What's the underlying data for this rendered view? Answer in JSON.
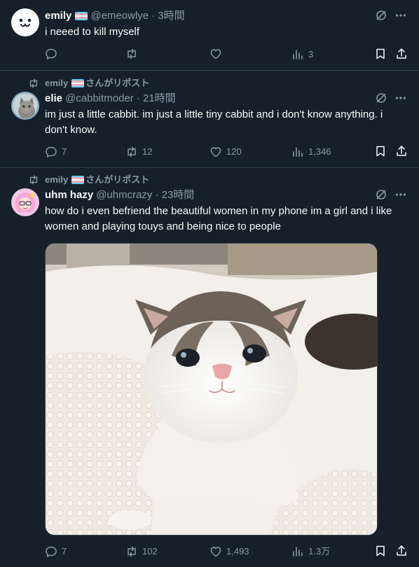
{
  "tweets": [
    {
      "name": "emily",
      "handle": "@emeowlye",
      "time": "· 3時間",
      "text": "i neeed to kill myself",
      "stats": {
        "replies": "",
        "retweets": "",
        "likes": "",
        "views": "3"
      }
    },
    {
      "retweeted_by": "emily",
      "retweet_suffix": "さんがリポスト",
      "name": "elie",
      "handle": "@cabbitmoder",
      "time": "· 21時間",
      "text": "im just a little cabbit. im just a little tiny cabbit and i don't know anything. i don't know.",
      "stats": {
        "replies": "7",
        "retweets": "12",
        "likes": "120",
        "views": "1,346"
      }
    },
    {
      "retweeted_by": "emily",
      "retweet_suffix": "さんがリポスト",
      "name": "uhm hazy",
      "handle": "@uhmcrazy",
      "time": "· 23時間",
      "text": "how do i even befriend the beautiful women in my phone im a girl and i like women and playing touys and being nice to people",
      "stats": {
        "replies": "7",
        "retweets": "102",
        "likes": "1,493",
        "views": "1.3万"
      }
    }
  ],
  "colors": {
    "background": "#15202b",
    "text": "#f7f9f9",
    "muted": "#8b98a5",
    "border": "#38444d",
    "flag_blue": "#5bcefa",
    "flag_pink": "#f5a9b8"
  },
  "icons": [
    "grok-icon",
    "more-icon",
    "reply-icon",
    "retweet-icon",
    "like-icon",
    "views-icon",
    "bookmark-icon",
    "share-icon"
  ]
}
